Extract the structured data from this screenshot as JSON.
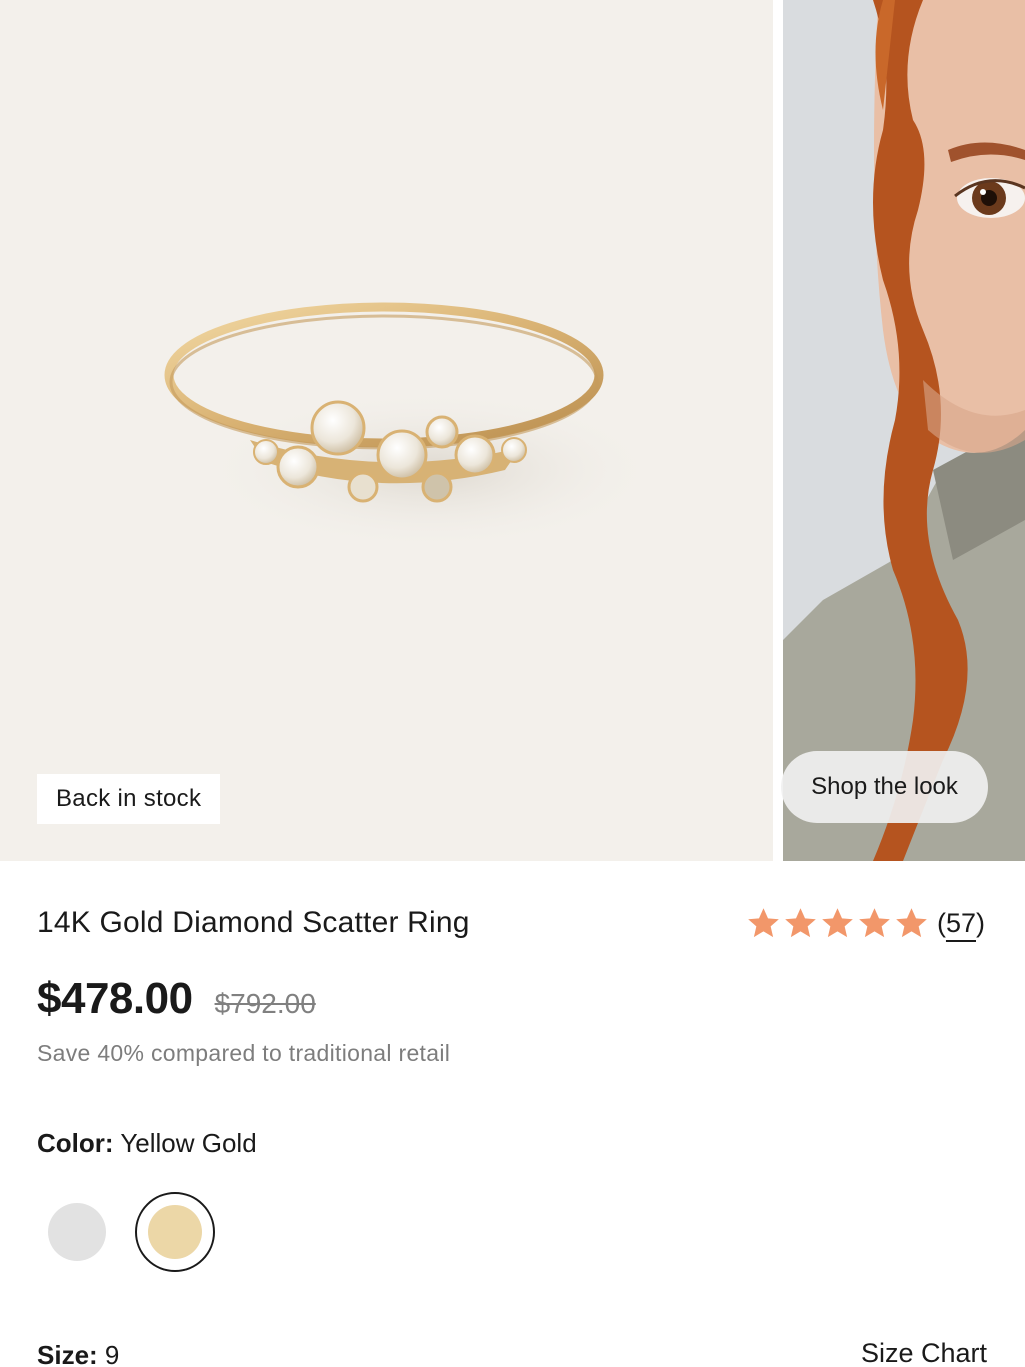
{
  "gallery": {
    "stock_badge": "Back in stock",
    "shop_look_label": "Shop the look"
  },
  "product": {
    "title": "14K Gold Diamond Scatter Ring",
    "rating_stars": 5,
    "review_count": "57",
    "price_current": "$478.00",
    "price_original": "$792.00",
    "savings_text": "Save 40% compared to traditional retail"
  },
  "color": {
    "label": "Color:",
    "selected": "Yellow Gold",
    "options": [
      {
        "name": "silver-swatch",
        "hex": "#e2e2e2"
      },
      {
        "name": "yellow-gold-swatch",
        "hex": "#ecd7a7"
      }
    ]
  },
  "size": {
    "label": "Size:",
    "selected": "9",
    "chart_link": "Size Chart"
  },
  "colors": {
    "star": "#f2976a",
    "product_bg": "#f3f0eb",
    "gold": "#ecd7a7"
  }
}
